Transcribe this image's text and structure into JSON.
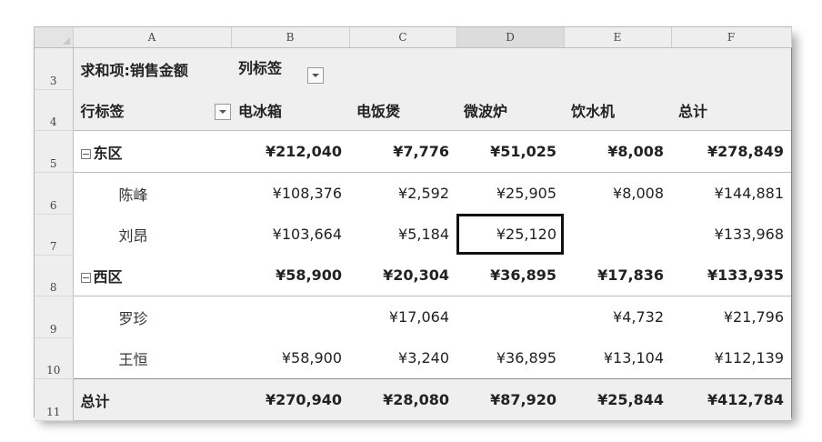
{
  "columns": [
    "A",
    "B",
    "C",
    "D",
    "E",
    "F"
  ],
  "rows": {
    "r3": {
      "num": "3",
      "a": "求和项:销售金额",
      "b": "列标签"
    },
    "r4": {
      "num": "4",
      "a": "行标签",
      "b": "电冰箱",
      "c": "电饭煲",
      "d": "微波炉",
      "e": "饮水机",
      "f": "总计"
    },
    "r5": {
      "num": "5",
      "a": "东区",
      "b": "¥212,040",
      "c": "¥7,776",
      "d": "¥51,025",
      "e": "¥8,008",
      "f": "¥278,849"
    },
    "r6": {
      "num": "6",
      "a": "陈峰",
      "b": "¥108,376",
      "c": "¥2,592",
      "d": "¥25,905",
      "e": "¥8,008",
      "f": "¥144,881"
    },
    "r7": {
      "num": "7",
      "a": "刘昂",
      "b": "¥103,664",
      "c": "¥5,184",
      "d": "¥25,120",
      "e": "",
      "f": "¥133,968"
    },
    "r8": {
      "num": "8",
      "a": "西区",
      "b": "¥58,900",
      "c": "¥20,304",
      "d": "¥36,895",
      "e": "¥17,836",
      "f": "¥133,935"
    },
    "r9": {
      "num": "9",
      "a": "罗珍",
      "b": "",
      "c": "¥17,064",
      "d": "",
      "e": "¥4,732",
      "f": "¥21,796"
    },
    "r10": {
      "num": "10",
      "a": "王恒",
      "b": "¥58,900",
      "c": "¥3,240",
      "d": "¥36,895",
      "e": "¥13,104",
      "f": "¥112,139"
    },
    "r11": {
      "num": "11",
      "a": "总计",
      "b": "¥270,940",
      "c": "¥28,080",
      "d": "¥87,920",
      "e": "¥25,844",
      "f": "¥412,784"
    }
  }
}
